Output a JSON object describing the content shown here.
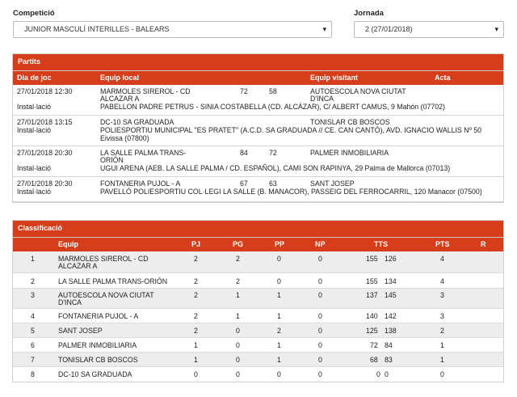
{
  "filters": {
    "competition_label": "Competició",
    "competition_value": "JUNIOR MASCULÍ INTERILLES - BALEARS",
    "round_label": "Jornada",
    "round_value": "2 (27/01/2018)",
    "caret": "▾"
  },
  "matches": {
    "title": "Partits",
    "headers": {
      "date": "Dia de joc",
      "home": "Equip local",
      "away": "Equip visitant",
      "report": "Acta"
    },
    "venue_label": "Instal·lació",
    "rows": [
      {
        "date": "27/01/2018 12:30",
        "home_l1": "MARMOLES SIREROL - CD",
        "home_l2": "ALCAZAR A",
        "home_score": "72",
        "away_score": "58",
        "away_l1": "AUTOESCOLA NOVA CIUTAT",
        "away_l2": "D'INCA",
        "venue_l1": "PABELLON PADRE PETRUS - SINIA COSTABELLA (CD. ALCÁZAR), C/ ALBERT CAMUS, 9 Mahón (07702)",
        "venue_l2": ""
      },
      {
        "date": "27/01/2018 13:15",
        "home_l1": "DC-10 SA GRADUADA",
        "home_l2": "",
        "home_score": "",
        "away_score": "",
        "away_l1": "TONISLAR CB BOSCOS",
        "away_l2": "",
        "venue_l1": "POLIESPORTIU MUNICIPAL \"ES PRATET\" (A.C.D. SA GRADUADA // CE. CAN CANTÓ), AVD. IGNACIO WALLIS Nº 50",
        "venue_l2": "Eivissa (07800)"
      },
      {
        "date": "27/01/2018 20:30",
        "home_l1": "LA SALLE PALMA TRANS-",
        "home_l2": "ORIÓN",
        "home_score": "84",
        "away_score": "72",
        "away_l1": "PALMER INMOBILIARIA",
        "away_l2": "",
        "venue_l1": "UGUI ARENA (AEB. LA SALLE PALMA / CD. ESPAÑOL), CAMI SON RAPINYA, 29 Palma de Mallorca (07013)",
        "venue_l2": ""
      },
      {
        "date": "27/01/2018 20:30",
        "home_l1": "FONTANERIA PUJOL - A",
        "home_l2": "",
        "home_score": "67",
        "away_score": "63",
        "away_l1": "SANT JOSEP",
        "away_l2": "",
        "venue_l1": "PAVELLÓ POLIESPORTIU COL·LEGI LA SALLE (B. MANACOR), PASSEIG DEL FERROCARRIL, 120 Manacor (07500)",
        "venue_l2": ""
      }
    ]
  },
  "standings": {
    "title": "Classificació",
    "headers": {
      "team": "Equip",
      "pj": "PJ",
      "pg": "PG",
      "pp": "PP",
      "np": "NP",
      "tts": "TTS",
      "pts": "PTS",
      "r": "R"
    },
    "rows": [
      {
        "pos": "1",
        "team_l1": "MARMOLES SIREROL - CD",
        "team_l2": "ALCAZAR A",
        "pj": "2",
        "pg": "2",
        "pp": "0",
        "np": "0",
        "tf": "155",
        "ta": "126",
        "pts": "4"
      },
      {
        "pos": "2",
        "team_l1": "LA SALLE PALMA TRANS-ORIÓN",
        "team_l2": "",
        "pj": "2",
        "pg": "2",
        "pp": "0",
        "np": "0",
        "tf": "155",
        "ta": "134",
        "pts": "4"
      },
      {
        "pos": "3",
        "team_l1": "AUTOESCOLA NOVA CIUTAT",
        "team_l2": "D'INCA",
        "pj": "2",
        "pg": "1",
        "pp": "1",
        "np": "0",
        "tf": "137",
        "ta": "145",
        "pts": "3"
      },
      {
        "pos": "4",
        "team_l1": "FONTANERIA PUJOL - A",
        "team_l2": "",
        "pj": "2",
        "pg": "1",
        "pp": "1",
        "np": "0",
        "tf": "140",
        "ta": "142",
        "pts": "3"
      },
      {
        "pos": "5",
        "team_l1": "SANT JOSEP",
        "team_l2": "",
        "pj": "2",
        "pg": "0",
        "pp": "2",
        "np": "0",
        "tf": "125",
        "ta": "138",
        "pts": "2"
      },
      {
        "pos": "6",
        "team_l1": "PALMER INMOBILIARIA",
        "team_l2": "",
        "pj": "1",
        "pg": "0",
        "pp": "1",
        "np": "0",
        "tf": "72",
        "ta": "84",
        "pts": "1"
      },
      {
        "pos": "7",
        "team_l1": "TONISLAR CB BOSCOS",
        "team_l2": "",
        "pj": "1",
        "pg": "0",
        "pp": "1",
        "np": "0",
        "tf": "68",
        "ta": "83",
        "pts": "1"
      },
      {
        "pos": "8",
        "team_l1": "DC-10 SA GRADUADA",
        "team_l2": "",
        "pj": "0",
        "pg": "0",
        "pp": "0",
        "np": "0",
        "tf": "0",
        "ta": "0",
        "pts": "0"
      }
    ]
  },
  "colors": {
    "accent": "#d63d1a",
    "alt_row": "#ededed",
    "border": "#d0d0d0"
  }
}
